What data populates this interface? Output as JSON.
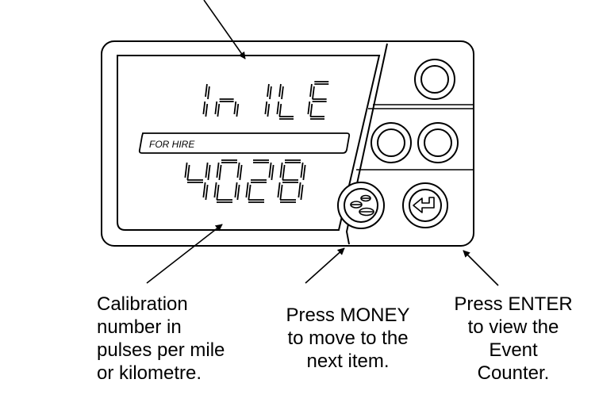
{
  "display": {
    "line1": "InILE",
    "mode_label": "FOR HIRE",
    "line2": "4028"
  },
  "captions": {
    "calibration": [
      "Calibration",
      "number in",
      "pulses per mile",
      "or kilometre."
    ],
    "money": [
      "Press MONEY",
      "to move to the",
      "next item."
    ],
    "enter": [
      "Press ENTER",
      "to view the",
      "Event",
      "Counter."
    ]
  },
  "icons": {
    "money_button": "coins-icon",
    "enter_button": "enter-return-icon"
  }
}
